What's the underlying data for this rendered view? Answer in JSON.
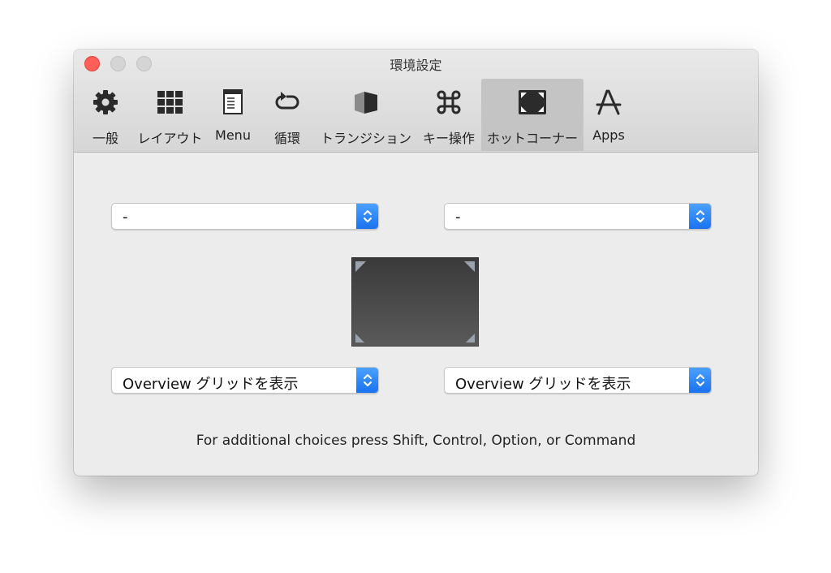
{
  "window": {
    "title": "環境設定"
  },
  "toolbar": {
    "items": [
      {
        "label": "一般",
        "icon": "gear-icon"
      },
      {
        "label": "レイアウト",
        "icon": "grid-icon"
      },
      {
        "label": "Menu",
        "icon": "menu-window-icon"
      },
      {
        "label": "循環",
        "icon": "cycle-icon"
      },
      {
        "label": "トランジション",
        "icon": "transition-cube-icon"
      },
      {
        "label": "キー操作",
        "icon": "command-key-icon"
      },
      {
        "label": "ホットコーナー",
        "icon": "hot-corner-screen-icon"
      },
      {
        "label": "Apps",
        "icon": "app-store-icon"
      }
    ],
    "active": "ホットコーナー"
  },
  "hot_corners": {
    "top_left": "-",
    "top_right": "-",
    "bottom_left": "Overview グリッドを表示",
    "bottom_right": "Overview グリッドを表示"
  },
  "hint": "For additional choices press Shift, Control, Option, or Command",
  "colors": {
    "close": "#ff5f57",
    "accent": "#1a72f0",
    "active_tab": "#c4c4c4"
  }
}
